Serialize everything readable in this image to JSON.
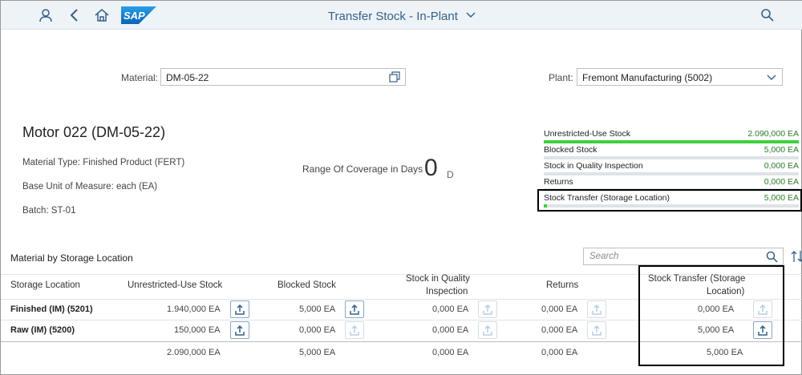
{
  "shell": {
    "title": "Transfer Stock - In-Plant",
    "icons": [
      "user-icon",
      "back-icon",
      "home-icon",
      "sap-logo",
      "search-icon"
    ],
    "logo_text": "SAP"
  },
  "filters": {
    "material_label": "Material:",
    "material_value": "DM-05-22",
    "plant_label": "Plant:",
    "plant_value": "Fremont Manufacturing (5002)"
  },
  "header": {
    "title": "Motor 022 (DM-05-22)",
    "material_type": "Material Type: Finished Product (FERT)",
    "base_unit": "Base Unit of Measure: each (EA)",
    "batch": "Batch: ST-01",
    "coverage_label": "Range Of Coverage in Days",
    "coverage_value": "0",
    "coverage_unit": "D"
  },
  "stock": [
    {
      "label": "Unrestricted-Use Stock",
      "value": "2.090,000 EA",
      "fill": 1.0
    },
    {
      "label": "Blocked Stock",
      "value": "5,000 EA",
      "fill": 0.0
    },
    {
      "label": "Stock in Quality Inspection",
      "value": "0,000 EA",
      "fill": 0.0
    },
    {
      "label": "Returns",
      "value": "0,000 EA",
      "fill": 0.0
    },
    {
      "label": "Stock Transfer (Storage Location)",
      "value": "5,000 EA",
      "fill": 0.01
    }
  ],
  "table": {
    "title": "Material by Storage Location",
    "search_placeholder": "Search",
    "columns": [
      "Storage Location",
      "Unrestricted-Use Stock",
      "Blocked Stock",
      "Stock in Quality",
      "Inspection",
      "Returns",
      "Stock Transfer (Storage",
      "Location)"
    ],
    "rows": [
      {
        "location": "Finished (IM) (5201)",
        "unrestricted": "1.940,000 EA",
        "blocked": "5,000 EA",
        "quality": "0,000 EA",
        "returns": "0,000 EA",
        "transfer": "0,000 EA"
      },
      {
        "location": "Raw (IM) (5200)",
        "unrestricted": "150,000 EA",
        "blocked": "0,000 EA",
        "quality": "0,000 EA",
        "returns": "0,000 EA",
        "transfer": "5,000 EA"
      }
    ],
    "totals": {
      "unrestricted": "2.090,000 EA",
      "blocked": "5,000 EA",
      "quality": "0,000 EA",
      "returns": "0,000 EA",
      "transfer": "5,000 EA"
    }
  },
  "colors": {
    "accent": "#346187",
    "stock_fill": "#3fcf3f",
    "stock_value": "#2b7d2b"
  }
}
